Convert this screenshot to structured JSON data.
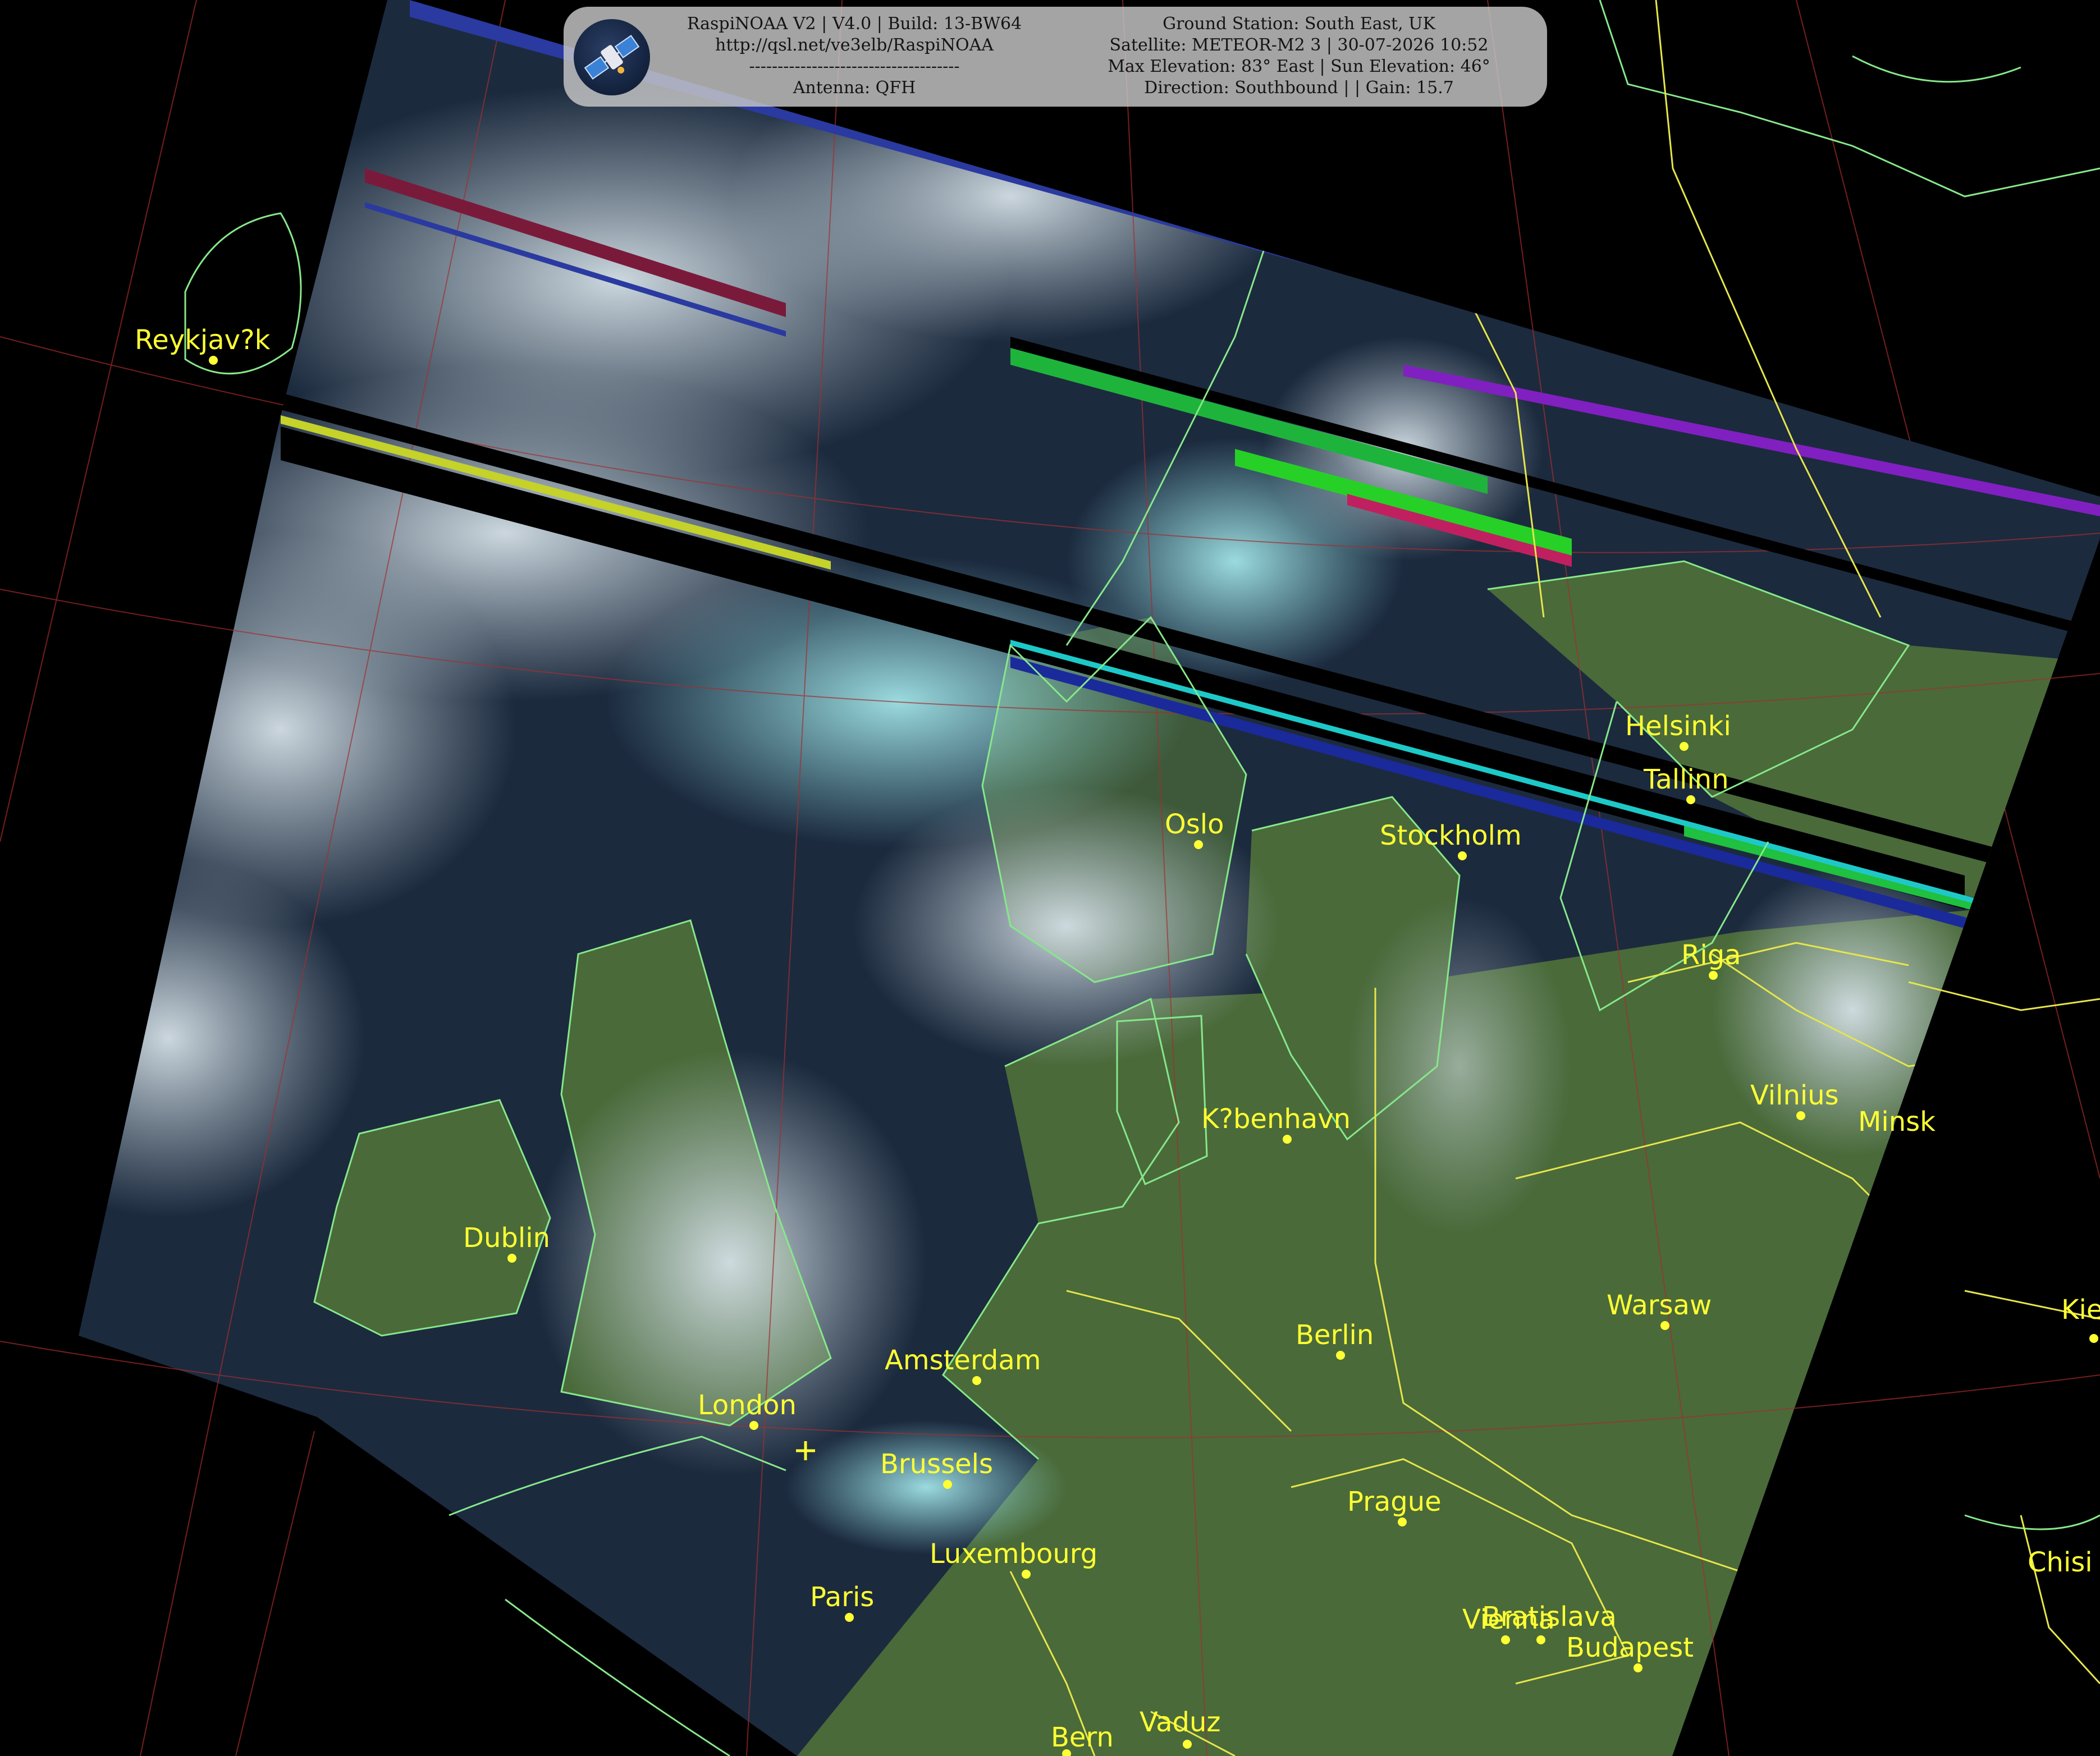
{
  "header": {
    "left_lines": [
      "RaspiNOAA V2 | V4.0 | Build: 13-BW64",
      "http://qsl.net/ve3elb/RaspiNOAA",
      "-------------------------------------",
      "Antenna: QFH"
    ],
    "right_lines": [
      "Ground Station: South East, UK",
      "Satellite: METEOR-M2 3 | 30-07-2026 10:52",
      "Max Elevation: 83° East | Sun Elevation: 46°",
      "Direction: Southbound | | Gain: 15.7"
    ],
    "logo_icon": "satellite-icon"
  },
  "map": {
    "cities": [
      {
        "name": "Reykjav?k"
      },
      {
        "name": "Helsinki"
      },
      {
        "name": "Tallinn"
      },
      {
        "name": "Oslo"
      },
      {
        "name": "Stockholm"
      },
      {
        "name": "Riga"
      },
      {
        "name": "Vilnius"
      },
      {
        "name": "Minsk"
      },
      {
        "name": "K?benhavn"
      },
      {
        "name": "Dublin"
      },
      {
        "name": "Warsaw"
      },
      {
        "name": "Berlin"
      },
      {
        "name": "Amsterdam"
      },
      {
        "name": "London"
      },
      {
        "name": "Brussels"
      },
      {
        "name": "Prague"
      },
      {
        "name": "Luxembourg"
      },
      {
        "name": "Paris"
      },
      {
        "name": "Vienna"
      },
      {
        "name": "Bratislava"
      },
      {
        "name": "Budapest"
      },
      {
        "name": "Kie"
      },
      {
        "name": "Chisi"
      },
      {
        "name": "Bern"
      },
      {
        "name": "Vaduz"
      }
    ],
    "colors": {
      "background": "#000000",
      "coastline": "#86e88a",
      "borders": "#e6e64a",
      "graticule": "#8a2424",
      "city": "#ffff33",
      "sea": "#1c2a3e",
      "cloud": "#b9c9d2",
      "land": "#4a6a3a"
    },
    "station_marker_icon": "ground-station-cross-icon"
  }
}
